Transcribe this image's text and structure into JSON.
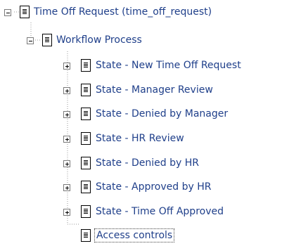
{
  "tree": {
    "root": {
      "label": "Time Off Request (time_off_request)",
      "expanded": true,
      "icon": "document-icon"
    },
    "workflow": {
      "label": "Workflow Process",
      "expanded": true,
      "icon": "document-icon"
    },
    "states": [
      {
        "label": "State - New Time Off Request",
        "expanded": false
      },
      {
        "label": "State - Manager Review",
        "expanded": false
      },
      {
        "label": "State - Denied by Manager",
        "expanded": false
      },
      {
        "label": "State - HR Review",
        "expanded": false
      },
      {
        "label": "State - Denied by HR",
        "expanded": false
      },
      {
        "label": "State - Approved by HR",
        "expanded": false
      },
      {
        "label": "State - Time Off Approved",
        "expanded": false
      }
    ],
    "access_controls": {
      "label": "Access controls",
      "selected": true
    },
    "colors": {
      "text": "#1f3f8a",
      "connector": "#999999"
    }
  }
}
